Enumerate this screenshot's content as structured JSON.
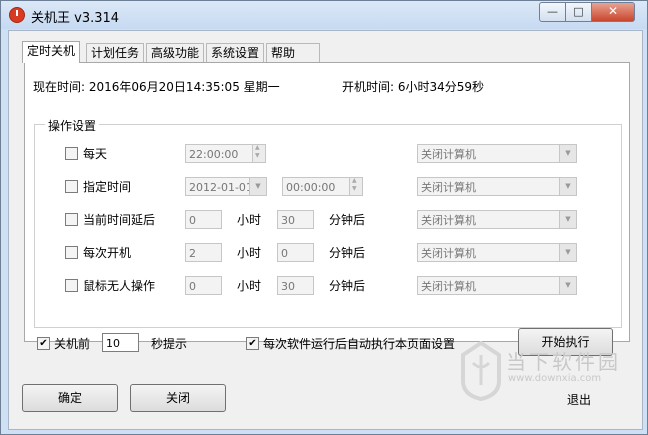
{
  "window": {
    "title": "关机王 v3.314",
    "min_symbol": "—",
    "max_symbol": "□",
    "close_symbol": "✕"
  },
  "tabs": [
    {
      "label": "定时关机",
      "active": true
    },
    {
      "label": "计划任务"
    },
    {
      "label": "高级功能"
    },
    {
      "label": "系统设置"
    },
    {
      "label": "帮助"
    }
  ],
  "status": {
    "current_time": "现在时间: 2016年06月20日14:35:05 星期一",
    "uptime": "开机时间: 6小时34分59秒"
  },
  "group": {
    "title": "操作设置",
    "rows": [
      {
        "label": "每天",
        "checked": false,
        "time": "22:00:00",
        "action": "关闭计算机"
      },
      {
        "label": "指定时间",
        "checked": false,
        "date": "2012-01-01",
        "time": "00:00:00",
        "action": "关闭计算机"
      },
      {
        "label": "当前时间延后",
        "checked": false,
        "hours": "0",
        "hours_unit": "小时",
        "minutes": "30",
        "minutes_unit": "分钟后",
        "action": "关闭计算机"
      },
      {
        "label": "每次开机",
        "checked": false,
        "hours": "2",
        "hours_unit": "小时",
        "minutes": "0",
        "minutes_unit": "分钟后",
        "action": "关闭计算机"
      },
      {
        "label": "鼠标无人操作",
        "checked": false,
        "hours": "0",
        "hours_unit": "小时",
        "minutes": "30",
        "minutes_unit": "分钟后",
        "action": "关闭计算机"
      }
    ]
  },
  "bottom": {
    "prompt_before_label": "关机前",
    "prompt_before_checked": true,
    "prompt_seconds": "10",
    "prompt_suffix": "秒提示",
    "auto_run_label": "每次软件运行后自动执行本页面设置",
    "auto_run_checked": true,
    "start_button": "开始执行"
  },
  "footer": {
    "ok_button": "确定",
    "close_button": "关闭",
    "exit_button": "退出"
  },
  "watermark": {
    "text": "当下软件园",
    "url": "www.downxia.com"
  },
  "icons": {
    "app_icon": "power-icon",
    "check_mark": "✔",
    "dropdown": "▼"
  }
}
